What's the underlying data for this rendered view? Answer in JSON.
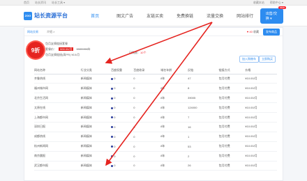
{
  "topbar": {
    "left": [
      "首页",
      "站长资讯",
      "站长工具 ▾"
    ],
    "right": [
      "收藏本站",
      "帮助中心 ▾"
    ]
  },
  "header": {
    "logo_badge": "ZGG",
    "logo_text": "站长资源平台",
    "nav": [
      "首页",
      "图文广告",
      "友链买卖",
      "免费换链",
      "流量交换",
      "网站排行"
    ],
    "active_index": 0,
    "cta_label": "出售/交换 ▾",
    "cta_badge": "NEW"
  },
  "crumb": {
    "link": "网站交易",
    "item": "介绍 >",
    "fav_count": "40",
    "fav_label": "收藏",
    "buy_label": "发布商品"
  },
  "promo": {
    "discount": "9折",
    "line1": "包月友情链接套餐",
    "price_label": "套餐价：",
    "price": "¥90.00/月",
    "orig_price": "¥100.00/月",
    "line3": "包月友情链接(高PR) ¥10/月",
    "mid_label": "已购数：",
    "mid_value": "10个",
    "btn_add": "加入购物车",
    "btn_buy": "立即购买"
  },
  "table": {
    "headers": [
      "网站名称",
      "行业分类",
      "百度权重",
      "百度收录",
      "域名年龄",
      "反链",
      "链接方式",
      "价格"
    ],
    "rows": [
      [
        "齐鲁热线",
        "新闻媒体",
        "0",
        "0",
        "8年",
        "47",
        "包月付费",
        "¥10.00/月"
      ],
      [
        "福州城市网",
        "新闻媒体",
        "0",
        "0",
        "8年",
        "8",
        "包月付费",
        "¥10.00/月"
      ],
      [
        "北京生活网",
        "新闻媒体",
        "0",
        "0",
        "8年",
        "39005",
        "包月付费",
        "¥10.00/月"
      ],
      [
        "太原在线",
        "新闻媒体",
        "0",
        "0",
        "8年",
        "124000",
        "包月付费",
        "¥10.00/月"
      ],
      [
        "上海都市网",
        "新闻媒体",
        "0",
        "0",
        "8年",
        "7",
        "包月付费",
        "¥10.00/月"
      ],
      [
        "深圳日报",
        "新闻媒体",
        "0",
        "0",
        "8年",
        "16",
        "包月付费",
        "¥10.00/月"
      ],
      [
        "成都热线",
        "新闻媒体",
        "0",
        "0",
        "8年",
        "1",
        "包月付费",
        "¥10.00/月"
      ],
      [
        "杭州新闻网",
        "新闻媒体",
        "0",
        "0",
        "8年",
        "53",
        "包月付费",
        "¥10.00/月"
      ],
      [
        "南京晨报",
        "新闻媒体",
        "0",
        "0",
        "8年",
        "2",
        "包月付费",
        "¥10.00/月"
      ],
      [
        "武汉都市报",
        "新闻媒体",
        "0",
        "0",
        "8年",
        "26",
        "包月付费",
        "¥10.00/月"
      ]
    ]
  },
  "colors": {
    "accent": "#2d8cf0",
    "annotation": "#e5231f"
  }
}
